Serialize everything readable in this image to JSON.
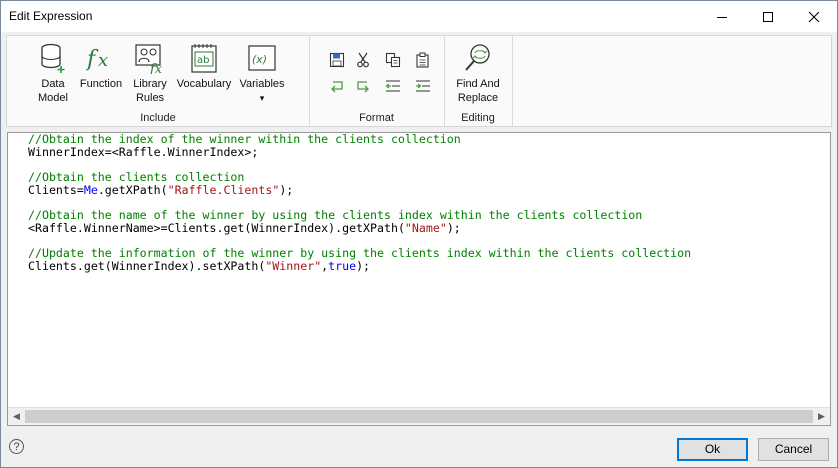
{
  "window": {
    "title": "Edit Expression"
  },
  "ribbon": {
    "include": {
      "label": "Include",
      "buttons": [
        {
          "id": "data-model",
          "line1": "Data",
          "line2": "Model",
          "icon": "database-add-icon"
        },
        {
          "id": "function",
          "line1": "Function",
          "line2": "",
          "icon": "fx-icon"
        },
        {
          "id": "library-rules",
          "line1": "Library",
          "line2": "Rules",
          "icon": "library-rules-icon"
        },
        {
          "id": "vocabulary",
          "line1": "Vocabulary",
          "line2": "",
          "icon": "vocabulary-icon"
        },
        {
          "id": "variables",
          "line1": "Variables",
          "line2": "▾",
          "icon": "variables-icon"
        }
      ]
    },
    "format": {
      "label": "Format",
      "buttons": [
        "save-icon",
        "cut-icon",
        "copy-icon",
        "paste-icon",
        "undo-icon",
        "redo-icon",
        "outdent-icon",
        "indent-icon"
      ]
    },
    "editing": {
      "label": "Editing",
      "find_replace": {
        "line1": "Find And",
        "line2": "Replace",
        "icon": "find-replace-icon"
      }
    }
  },
  "code": {
    "lines": [
      [
        {
          "t": "cm",
          "v": "//Obtain the index of the winner within the clients collection"
        }
      ],
      [
        {
          "t": "tx",
          "v": "WinnerIndex=<Raffle.WinnerIndex>;"
        }
      ],
      [],
      [
        {
          "t": "cm",
          "v": "//Obtain the clients collection"
        }
      ],
      [
        {
          "t": "tx",
          "v": "Clients="
        },
        {
          "t": "kw",
          "v": "Me"
        },
        {
          "t": "tx",
          "v": ".getXPath("
        },
        {
          "t": "st",
          "v": "\"Raffle.Clients\""
        },
        {
          "t": "tx",
          "v": ");"
        }
      ],
      [],
      [
        {
          "t": "cm",
          "v": "//Obtain the name of the winner by using the clients index within the clients collection"
        }
      ],
      [
        {
          "t": "tx",
          "v": "<Raffle.WinnerName>=Clients.get(WinnerIndex).getXPath("
        },
        {
          "t": "st",
          "v": "\"Name\""
        },
        {
          "t": "tx",
          "v": ");"
        }
      ],
      [],
      [
        {
          "t": "cm",
          "v": "//Update the information of the winner by using the clients index within the clients collection"
        }
      ],
      [
        {
          "t": "tx",
          "v": "Clients.get(WinnerIndex).setXPath("
        },
        {
          "t": "st",
          "v": "\"Winner\""
        },
        {
          "t": "tx",
          "v": ","
        },
        {
          "t": "kw",
          "v": "true"
        },
        {
          "t": "tx",
          "v": ");"
        }
      ]
    ]
  },
  "footer": {
    "help": "?",
    "ok_label": "Ok",
    "cancel_label": "Cancel"
  },
  "colors": {
    "comment": "#008000",
    "keyword": "#0000ff",
    "string": "#a31515",
    "accent": "#0078d7"
  }
}
